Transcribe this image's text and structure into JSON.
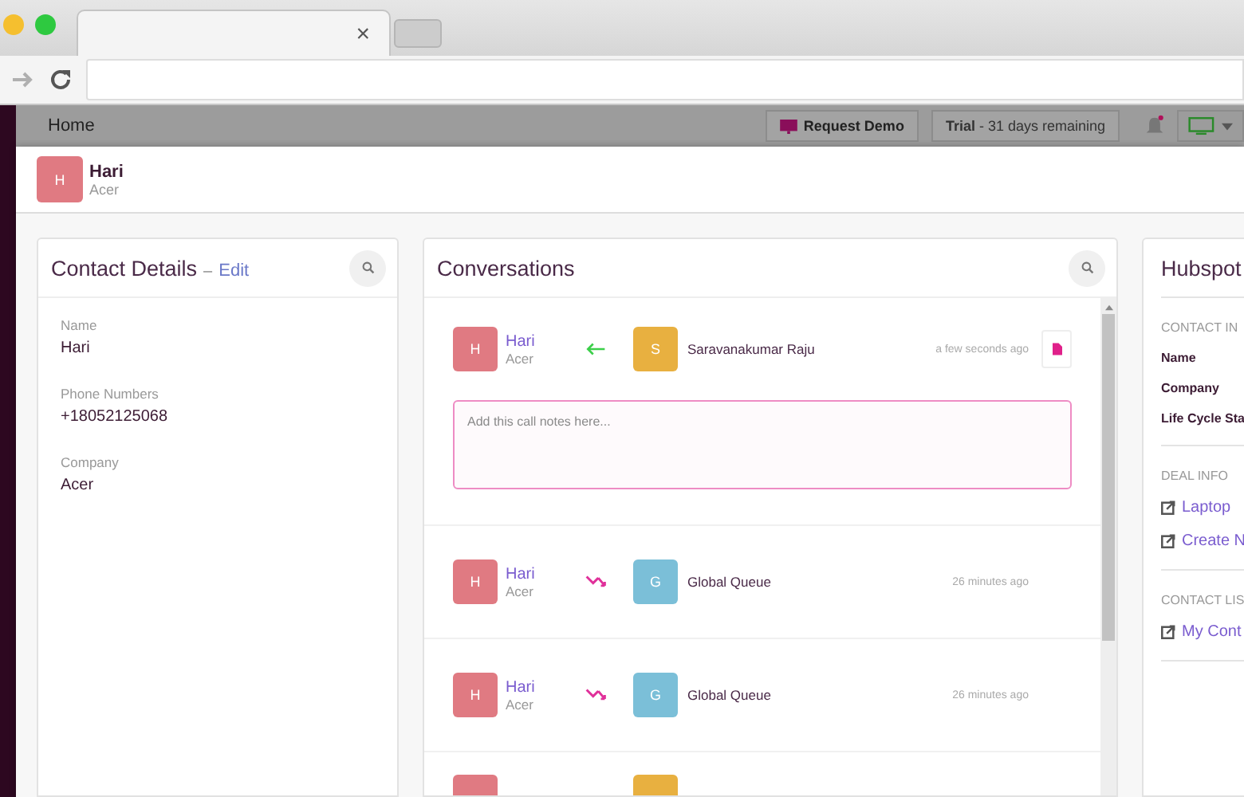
{
  "browser": {
    "tab_close": "×"
  },
  "topbar": {
    "home": "Home",
    "request_demo": "Request Demo",
    "trial": "**Trial** - 31 days remaining",
    "notification_dot": true
  },
  "contact_header": {
    "initial": "H",
    "name": "Hari",
    "company": "Acer",
    "color": "#e07a82"
  },
  "contact_details": {
    "title": "Contact Details",
    "edit_separator": "–",
    "edit": "Edit",
    "fields": [
      {
        "label": "Name",
        "value": "Hari"
      },
      {
        "label": "Phone Numbers",
        "value": "+18052125068"
      },
      {
        "label": "Company",
        "value": "Acer"
      }
    ]
  },
  "conversations": {
    "title": "Conversations",
    "items": [
      {
        "kind": "incoming",
        "caller": {
          "initial": "H",
          "name": "Hari",
          "company": "Acer",
          "color": "#e07a82"
        },
        "agent": {
          "initial": "S",
          "name": "Saravanakumar Raju",
          "color": "#e8b040"
        },
        "time": "a few seconds ago",
        "has_note": true,
        "expanded": true,
        "notes_placeholder": "Add this call notes here..."
      },
      {
        "kind": "missed",
        "caller": {
          "initial": "H",
          "name": "Hari",
          "company": "Acer",
          "color": "#e07a82"
        },
        "agent": {
          "initial": "G",
          "name": "Global Queue",
          "color": "#7bbfd8"
        },
        "time": "26 minutes ago",
        "has_note": false,
        "expanded": false
      },
      {
        "kind": "missed",
        "caller": {
          "initial": "H",
          "name": "Hari",
          "company": "Acer",
          "color": "#e07a82"
        },
        "agent": {
          "initial": "G",
          "name": "Global Queue",
          "color": "#7bbfd8"
        },
        "time": "26 minutes ago",
        "has_note": false,
        "expanded": false
      }
    ],
    "partial_row": {
      "caller": {
        "color": "#e07a82"
      },
      "agent": {
        "color": "#e8b040"
      }
    }
  },
  "hubspot": {
    "title": "Hubspot",
    "sections": [
      {
        "heading": "CONTACT IN",
        "items": [
          {
            "kind": "field",
            "text": "Name"
          },
          {
            "kind": "field",
            "text": "Company"
          },
          {
            "kind": "field",
            "text": "Life Cycle Sta"
          }
        ]
      },
      {
        "heading": "DEAL INFO",
        "items": [
          {
            "kind": "link",
            "text": "Laptop"
          },
          {
            "kind": "link",
            "text": "Create N"
          }
        ]
      },
      {
        "heading": "CONTACT LIS",
        "items": [
          {
            "kind": "link",
            "text": "My Cont"
          }
        ]
      }
    ]
  }
}
